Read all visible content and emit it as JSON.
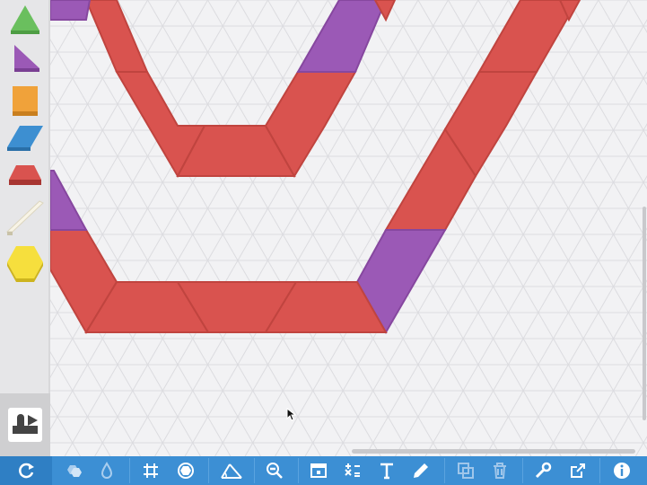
{
  "colors": {
    "background": "#f2f2f4",
    "grid_line": "#dcdce0",
    "trapezoid": "#d9534f",
    "trapezoid_edge": "#c0443f",
    "rhombus": "#9b59b6",
    "rhombus_edge": "#86479f",
    "triangle": "#6abf5e",
    "square": "#f0a23a",
    "blue_rhombus": "#3d8fd1",
    "hexagon": "#f6df3d",
    "toolbar": "#3c8fd4",
    "toolbar_icon": "#ffffff"
  },
  "palette": [
    {
      "name": "triangle-shape-button",
      "icon": "green-triangle-icon"
    },
    {
      "name": "right-triangle-shape-button",
      "icon": "purple-triangle-icon"
    },
    {
      "name": "square-shape-button",
      "icon": "orange-square-icon"
    },
    {
      "name": "rhombus-shape-button",
      "icon": "blue-rhombus-icon"
    },
    {
      "name": "trapezoid-shape-button",
      "icon": "red-trapezoid-icon"
    },
    {
      "name": "thin-rhombus-shape-button",
      "icon": "tan-rhombus-icon"
    },
    {
      "name": "hexagon-shape-button",
      "icon": "yellow-hexagon-icon"
    }
  ],
  "toolbar": {
    "buttons": [
      {
        "name": "reset-button",
        "icon": "refresh-icon"
      },
      {
        "name": "shapes-button",
        "icon": "hexagons-icon"
      },
      {
        "name": "fill-color-button",
        "icon": "droplet-icon"
      },
      {
        "name": "grid-button",
        "icon": "grid-icon"
      },
      {
        "name": "snap-button",
        "icon": "circle-snap-icon"
      },
      {
        "name": "angle-button",
        "icon": "angle-icon"
      },
      {
        "name": "zoom-out-button",
        "icon": "zoom-out-icon"
      },
      {
        "name": "window-button",
        "icon": "window-icon"
      },
      {
        "name": "calculator-button",
        "icon": "math-symbols-icon"
      },
      {
        "name": "text-button",
        "icon": "text-icon"
      },
      {
        "name": "pen-button",
        "icon": "pen-icon"
      },
      {
        "name": "duplicate-button",
        "icon": "duplicate-icon"
      },
      {
        "name": "delete-button",
        "icon": "trash-icon"
      },
      {
        "name": "tools-button",
        "icon": "wrench-icon"
      },
      {
        "name": "share-button",
        "icon": "share-icon"
      },
      {
        "name": "info-button",
        "icon": "info-icon"
      }
    ]
  }
}
